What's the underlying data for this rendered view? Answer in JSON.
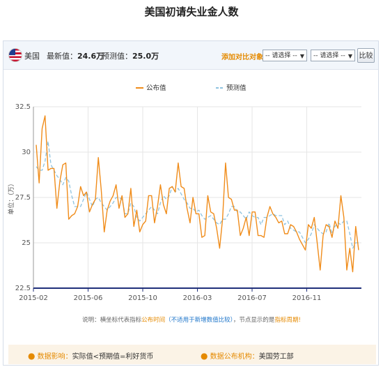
{
  "page": {
    "title": "美国初请失业金人数"
  },
  "toolbar": {
    "country": "美国",
    "latest_label": "最新值：",
    "latest_value": "24.6万",
    "forecast_label": "预测值：",
    "forecast_value": "25.0万",
    "compare_label": "添加对比对象：",
    "select1": "-- 请选择 --",
    "select2": "-- 请选择 --",
    "compare_button": "比较"
  },
  "note": {
    "part1": "说明：横坐标代表指标",
    "part2": "公布时间",
    "part3": "（不适用于新增数值比较）",
    "part4": "，节点显示的是",
    "part5": "指标周期!"
  },
  "info": {
    "impact_label": "数据影响：",
    "impact_value": "实际值<预期值=利好货币",
    "agency_label": "数据公布机构：",
    "agency_value": "美国劳工部"
  },
  "colors": {
    "actual": "#f08c1a",
    "forecast": "#8ec3e0",
    "axis": "#1f2f7a",
    "grid": "#e6e6e6"
  },
  "chart_data": {
    "type": "line",
    "title": "",
    "ylabel": "单位：（万）",
    "ylim": [
      22.5,
      32.5
    ],
    "yticks": [
      22.5,
      25,
      27.5,
      30,
      32.5
    ],
    "x_labels": [
      "2015-02",
      "2015-06",
      "2015-10",
      "2016-03",
      "2016-07",
      "2016-11"
    ],
    "legend": [
      "公布值",
      "预测值"
    ],
    "legend_position": "top-center",
    "series": [
      {
        "name": "公布值",
        "style": "solid",
        "values": [
          30.4,
          28.3,
          31.3,
          32.0,
          29.0,
          29.1,
          29.1,
          26.9,
          28.4,
          29.3,
          29.4,
          26.3,
          26.5,
          26.6,
          27.0,
          28.1,
          27.6,
          27.8,
          26.7,
          27.1,
          27.4,
          29.7,
          27.9,
          25.6,
          26.8,
          27.3,
          27.6,
          28.2,
          26.9,
          27.6,
          26.4,
          26.6,
          28.0,
          25.9,
          26.8,
          25.6,
          26.0,
          26.2,
          27.6,
          27.6,
          26.1,
          27.0,
          28.2,
          27.1,
          26.6,
          28.0,
          28.1,
          27.8,
          29.4,
          28.1,
          28.0,
          26.9,
          26.1,
          27.5,
          26.6,
          26.6,
          25.3,
          25.4,
          27.6,
          26.7,
          26.6,
          25.8,
          24.7,
          26.3,
          29.4,
          27.5,
          27.4,
          26.8,
          26.8,
          25.4,
          25.8,
          26.4,
          25.4,
          26.7,
          26.7,
          25.4,
          25.4,
          25.3,
          26.4,
          27.0,
          26.6,
          26.4,
          26.1,
          26.2,
          25.5,
          25.5,
          26.0,
          25.9,
          25.6,
          25.2,
          24.9,
          24.6,
          26.0,
          25.8,
          26.4,
          25.0,
          23.5,
          25.4,
          26.0,
          25.9,
          25.3,
          26.2,
          25.8,
          27.6,
          26.4,
          23.5,
          24.7,
          23.4,
          25.9,
          24.6
        ]
      },
      {
        "name": "预测值",
        "style": "dashed",
        "values": [
          29.2,
          29.0,
          29.0,
          29.5,
          30.6,
          29.3,
          29.0,
          28.7,
          28.5,
          28.2,
          28.6,
          28.4,
          27.6,
          27.0,
          27.0,
          27.0,
          27.4,
          27.8,
          27.4,
          27.0,
          27.4,
          27.5,
          27.2,
          27.0,
          26.8,
          27.0,
          27.2,
          27.5,
          27.5,
          27.4,
          26.6,
          26.6,
          27.2,
          27.0,
          26.4,
          26.2,
          26.4,
          26.6,
          26.8,
          27.0,
          26.8,
          26.6,
          27.2,
          27.6,
          27.4,
          27.6,
          28.1,
          27.8,
          28.0,
          27.7,
          27.4,
          27.2,
          26.9,
          26.9,
          26.7,
          26.8,
          26.5,
          26.3,
          26.4,
          26.5,
          26.3,
          26.1,
          26.0,
          26.3,
          26.3,
          26.6,
          27.0,
          27.0,
          26.7,
          26.7,
          26.5,
          26.3,
          26.7,
          26.5,
          26.4,
          26.4,
          26.0,
          26.4,
          26.4,
          26.5,
          26.6,
          26.5,
          26.5,
          26.5,
          26.0,
          26.2,
          25.8,
          25.7,
          25.6,
          25.6,
          25.3,
          25.0,
          25.2,
          25.5,
          26.0,
          25.8,
          25.6,
          25.5,
          25.6,
          26.1,
          25.5,
          25.9,
          26.1,
          26.0,
          26.2,
          26.2,
          25.5,
          24.7,
          25.0,
          25.0
        ]
      }
    ]
  }
}
